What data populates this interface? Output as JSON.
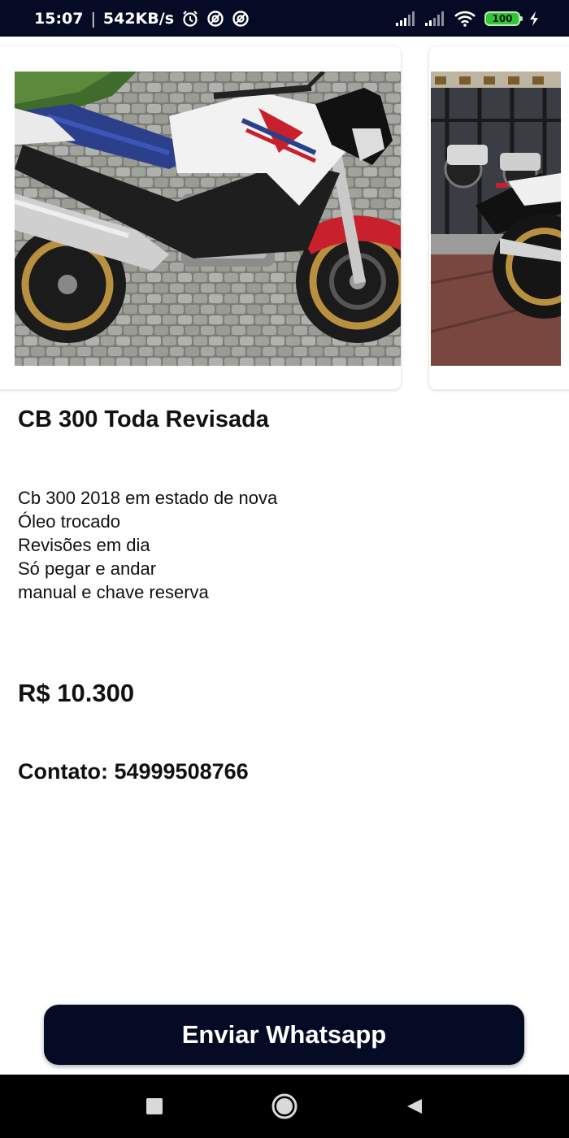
{
  "status_bar": {
    "time": "15:07",
    "separator": "|",
    "speed": "542KB/s",
    "battery": "100",
    "icons": [
      "alarm-icon",
      "sync-icon",
      "sync-icon",
      "signal-icon",
      "signal-icon",
      "wifi-icon",
      "battery-icon",
      "charging-icon"
    ]
  },
  "listing": {
    "title": "CB 300 Toda Revisada",
    "description": [
      "Cb 300 2018 em estado de nova",
      "Óleo trocado",
      "Revisões em dia",
      "Só pegar e andar",
      "manual e chave reserva"
    ],
    "price": "R$ 10.300",
    "contact": "Contato: 54999508766"
  },
  "actions": {
    "whatsapp_label": "Enviar Whatsapp"
  },
  "nav": {
    "buttons": [
      "recents-icon",
      "home-icon",
      "back-icon"
    ]
  },
  "colors": {
    "primary_dark": "#050b24",
    "battery_green": "#33c43a"
  }
}
